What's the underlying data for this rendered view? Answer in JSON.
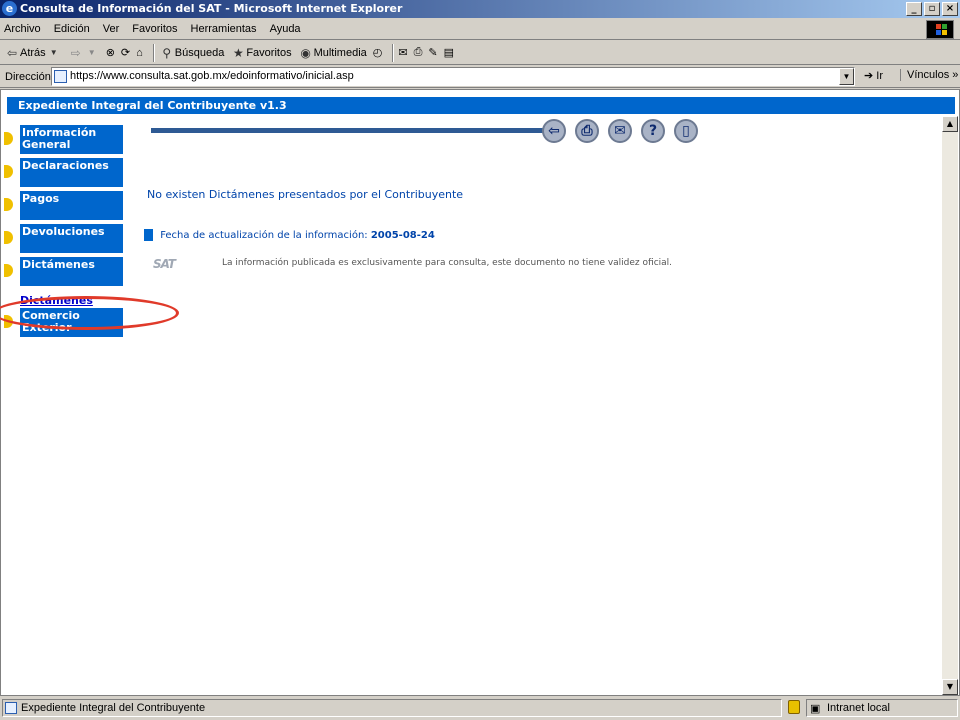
{
  "window": {
    "title": "Consulta de Información del SAT - Microsoft Internet Explorer",
    "buttons": [
      "_",
      "▫",
      "×"
    ]
  },
  "menu": [
    "Archivo",
    "Edición",
    "Ver",
    "Favoritos",
    "Herramientas",
    "Ayuda"
  ],
  "toolbar": {
    "back": "Atrás",
    "search": "Búsqueda",
    "favorites": "Favoritos",
    "media": "Multimedia"
  },
  "address": {
    "label": "Dirección",
    "url": "https://www.consulta.sat.gob.mx/edoinformativo/inicial.asp",
    "go": "Ir",
    "links": "Vínculos"
  },
  "page": {
    "banner": "Expediente Integral del Contribuyente v1.3",
    "nav": [
      {
        "label": "Información General"
      },
      {
        "label": "Declaraciones"
      },
      {
        "label": "Pagos"
      },
      {
        "label": "Devoluciones"
      },
      {
        "label": "Dictámenes"
      },
      {
        "label": "Comercio Exterior"
      }
    ],
    "nav_link": "Dictámenes",
    "message": "No existen Dictámenes presentados por el Contribuyente",
    "date_label": "Fecha de actualización de la información:",
    "date_value": "2005-08-24",
    "logo_text": "SAT",
    "disclaimer": "La información publicada es exclusivamente para consulta, este documento no tiene validez oficial.",
    "action_icons": [
      "back-arrow-icon",
      "printer-icon",
      "envelope-icon",
      "help-icon",
      "exit-door-icon"
    ]
  },
  "status": {
    "text": "Expediente Integral del Contribuyente",
    "zone": "Intranet local"
  },
  "colors": {
    "banner": "#0066cc",
    "nav": "#0066cc",
    "highlight": "#e03a2a"
  }
}
